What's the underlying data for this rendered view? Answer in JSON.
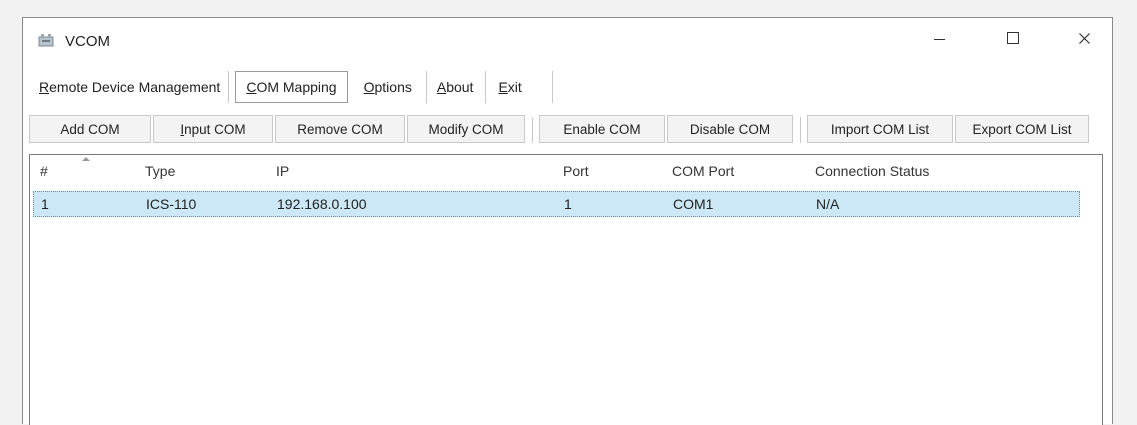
{
  "window": {
    "title": "VCOM",
    "accent_selection": "#cce8f6"
  },
  "menu": [
    {
      "pre": "",
      "ul": "R",
      "post": "emote Device Management"
    },
    {
      "pre": "",
      "ul": "C",
      "post": "OM Mapping"
    },
    {
      "pre": "",
      "ul": "O",
      "post": "ptions"
    },
    {
      "pre": "",
      "ul": "A",
      "post": "bout"
    },
    {
      "pre": "",
      "ul": "E",
      "post": "xit"
    }
  ],
  "toolbar": {
    "add_com": "Add COM",
    "input_com_ul": "I",
    "input_com_rest": "nput COM",
    "remove_com": "Remove COM",
    "modify_com": "Modify COM",
    "enable_com": "Enable COM",
    "disable_com": "Disable COM",
    "import_com_list": "Import COM List",
    "export_com_list": "Export COM List"
  },
  "table": {
    "columns": [
      "#",
      "Type",
      "IP",
      "Port",
      "COM Port",
      "Connection Status"
    ],
    "rows": [
      [
        "1",
        "ICS-110",
        "192.168.0.100",
        "1",
        "COM1",
        "N/A"
      ]
    ]
  }
}
